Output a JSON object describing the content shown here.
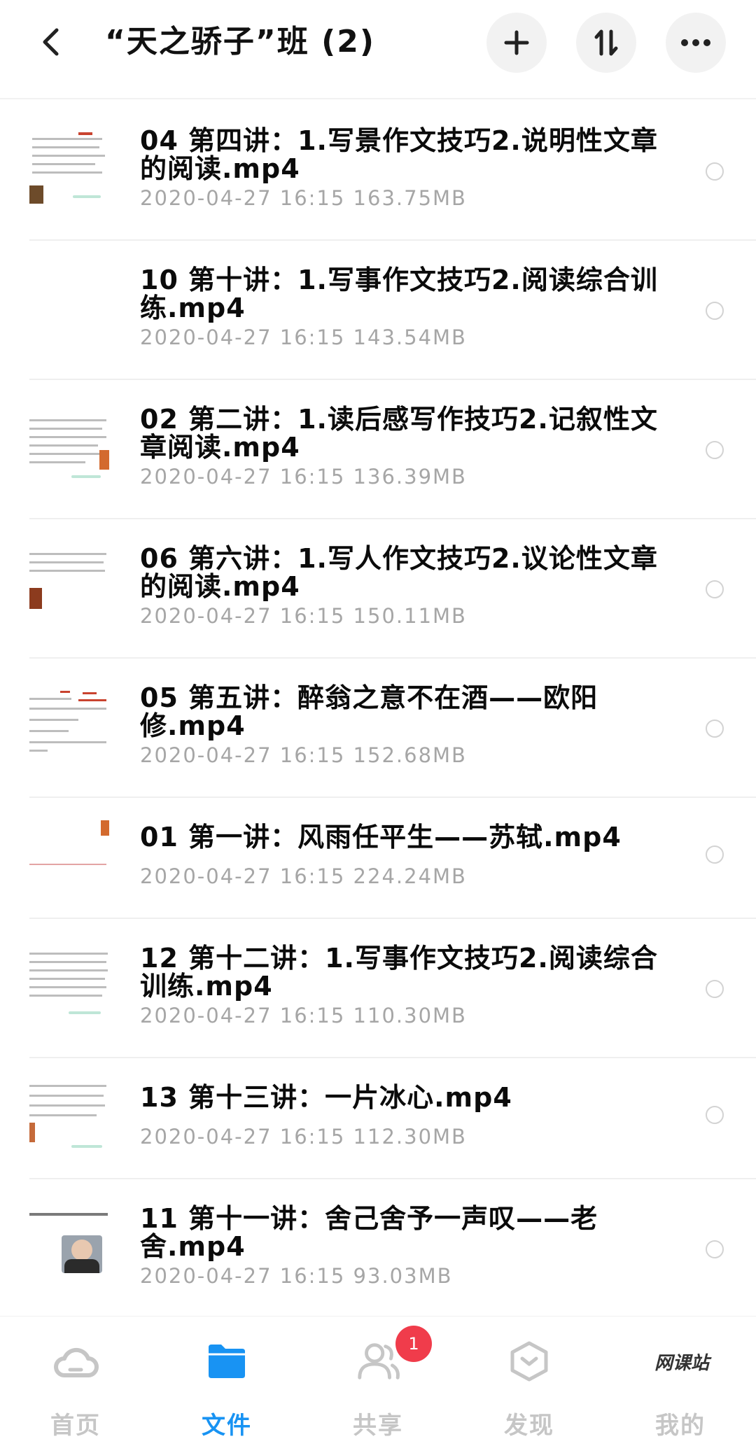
{
  "header": {
    "title": "“天之骄子”班 (2)",
    "icons": {
      "back": "chevron-left-icon",
      "add": "plus-icon",
      "sort": "sort-icon",
      "more": "more-icon"
    }
  },
  "files": [
    {
      "name": "04 第四讲：1.写景作文技巧2.说明性文章的阅读.mp4",
      "date": "2020-04-27 16:15",
      "size": "163.75MB"
    },
    {
      "name": "10 第十讲：1.写事作文技巧2.阅读综合训练.mp4",
      "date": "2020-04-27 16:15",
      "size": "143.54MB"
    },
    {
      "name": "02 第二讲：1.读后感写作技巧2.记叙性文章阅读.mp4",
      "date": "2020-04-27 16:15",
      "size": "136.39MB"
    },
    {
      "name": "06 第六讲：1.写人作文技巧2.议论性文章的阅读.mp4",
      "date": "2020-04-27 16:15",
      "size": "150.11MB"
    },
    {
      "name": "05 第五讲：醉翁之意不在酒——欧阳修.mp4",
      "date": "2020-04-27 16:15",
      "size": "152.68MB"
    },
    {
      "name": "01 第一讲：风雨任平生——苏轼.mp4",
      "date": "2020-04-27 16:15",
      "size": "224.24MB"
    },
    {
      "name": "12 第十二讲：1.写事作文技巧2.阅读综合训练.mp4",
      "date": "2020-04-27 16:15",
      "size": "110.30MB"
    },
    {
      "name": "13 第十三讲：一片冰心.mp4",
      "date": "2020-04-27 16:15",
      "size": "112.30MB"
    },
    {
      "name": "11 第十一讲：舍己舍予一声叹——老舍.mp4",
      "date": "2020-04-27 16:15",
      "size": "93.03MB"
    }
  ],
  "tabbar": {
    "tabs": [
      {
        "label": "首页",
        "icon": "cloud-icon"
      },
      {
        "label": "文件",
        "icon": "folder-icon"
      },
      {
        "label": "共享",
        "icon": "people-icon"
      },
      {
        "label": "发现",
        "icon": "discover-icon"
      },
      {
        "label": "我的",
        "icon": "wangkezhan-logo"
      }
    ],
    "active_index": 1,
    "share_badge": "1",
    "mine_logo_text": "网课站"
  },
  "colors": {
    "accent": "#1893f3",
    "badge": "#f03c4b",
    "meta": "#a6a6a6",
    "inactive": "#c6c6c6"
  }
}
